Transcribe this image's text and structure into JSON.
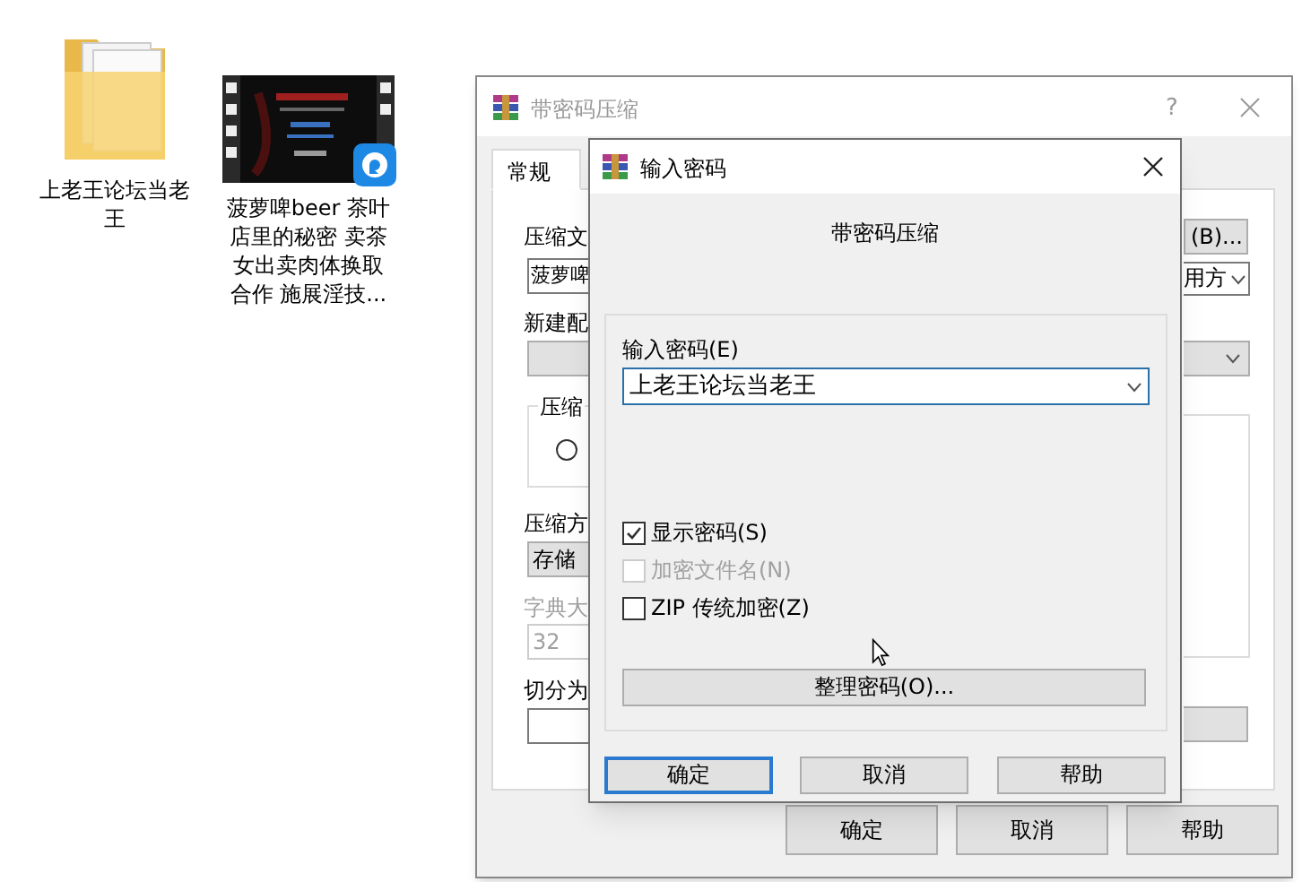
{
  "desktop_icons": [
    {
      "kind": "folder",
      "label": "上老王论坛当老王"
    },
    {
      "kind": "video",
      "label": "菠萝啤beer 茶叶店里的秘密 卖茶女出卖肉体换取合作 施展淫技..."
    }
  ],
  "back_window": {
    "title": "带密码压缩",
    "help": "?",
    "tabs": [
      {
        "label": "常规",
        "selected": true
      }
    ],
    "archive_label": "压缩文",
    "archive_value": "菠萝啤",
    "browse_button": "(B)...",
    "update_value": "用方",
    "profile_label": "新建配",
    "format_group_label": "压缩",
    "format_radio_checked": false,
    "method_label": "压缩方",
    "method_value": "存储",
    "dict_label": "字典大",
    "dict_value": "32",
    "dict_disabled": true,
    "split_label": "切分为",
    "buttons": [
      "确定",
      "取消",
      "帮助"
    ]
  },
  "dialog": {
    "title": "输入密码",
    "heading": "带密码压缩",
    "password_label": "输入密码(E)",
    "password_value": "上老王论坛当老王",
    "checkboxes": [
      {
        "label": "显示密码(S)",
        "checked": true,
        "disabled": false
      },
      {
        "label": "加密文件名(N)",
        "checked": false,
        "disabled": true
      },
      {
        "label": "ZIP 传统加密(Z)",
        "checked": false,
        "disabled": false
      }
    ],
    "organize_button": "整理密码(O)...",
    "buttons": [
      {
        "label": "确定",
        "focused": true
      },
      {
        "label": "取消",
        "focused": false
      },
      {
        "label": "帮助",
        "focused": false
      }
    ]
  }
}
